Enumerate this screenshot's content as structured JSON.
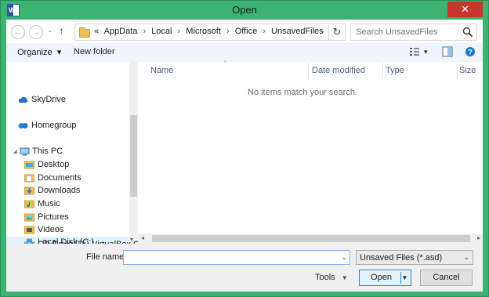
{
  "window": {
    "title": "Open",
    "app_icon_letter": "W",
    "close_glyph": "✕"
  },
  "nav": {
    "back_glyph": "←",
    "forward_glyph": "→",
    "recent_glyph": "⌄",
    "up_glyph": "↑"
  },
  "address": {
    "overflow_glyph": "«",
    "crumbs": [
      "AppData",
      "Local",
      "Microsoft",
      "Office",
      "UnsavedFiles"
    ],
    "separator": "›",
    "dropdown_glyph": "⌄",
    "refresh_glyph": "↻"
  },
  "search": {
    "placeholder": "Search UnsavedFiles"
  },
  "toolbar": {
    "organize_label": "Organize",
    "organize_dropdown": "▾",
    "new_folder_label": "New folder",
    "views_dropdown": "▾",
    "help_glyph": "?"
  },
  "navpane": {
    "skydrive": "SkyDrive",
    "homegroup": "Homegroup",
    "this_pc": "This PC",
    "expand_glyph": "◢",
    "folders": [
      "Desktop",
      "Documents",
      "Downloads",
      "Music",
      "Pictures",
      "Videos"
    ],
    "local_disk": "Local Disk (C:)",
    "cd_drive": "CD Drive (D:) VirtualBox Gue",
    "scroll_down": "▾"
  },
  "filelist": {
    "columns": [
      "Name",
      "Date modified",
      "Type",
      "Size"
    ],
    "sort_caret": "^",
    "empty_message": "No items match your search.",
    "scroll_left": "◂",
    "scroll_right": "▸"
  },
  "bottom": {
    "file_name_label": "File name:",
    "file_name_value": "",
    "file_name_dropdown": "⌄",
    "filter_value": "Unsaved Files (*.asd)",
    "filter_dropdown": "⌄",
    "tools_label": "Tools",
    "tools_dropdown": "▼",
    "open_label": "Open",
    "open_split": "▼",
    "cancel_label": "Cancel"
  },
  "colors": {
    "frame": "#3cb371",
    "close": "#c7362c",
    "folder": "#e8c15b",
    "accent": "#1979ca",
    "selected": "#e5f3fb"
  }
}
